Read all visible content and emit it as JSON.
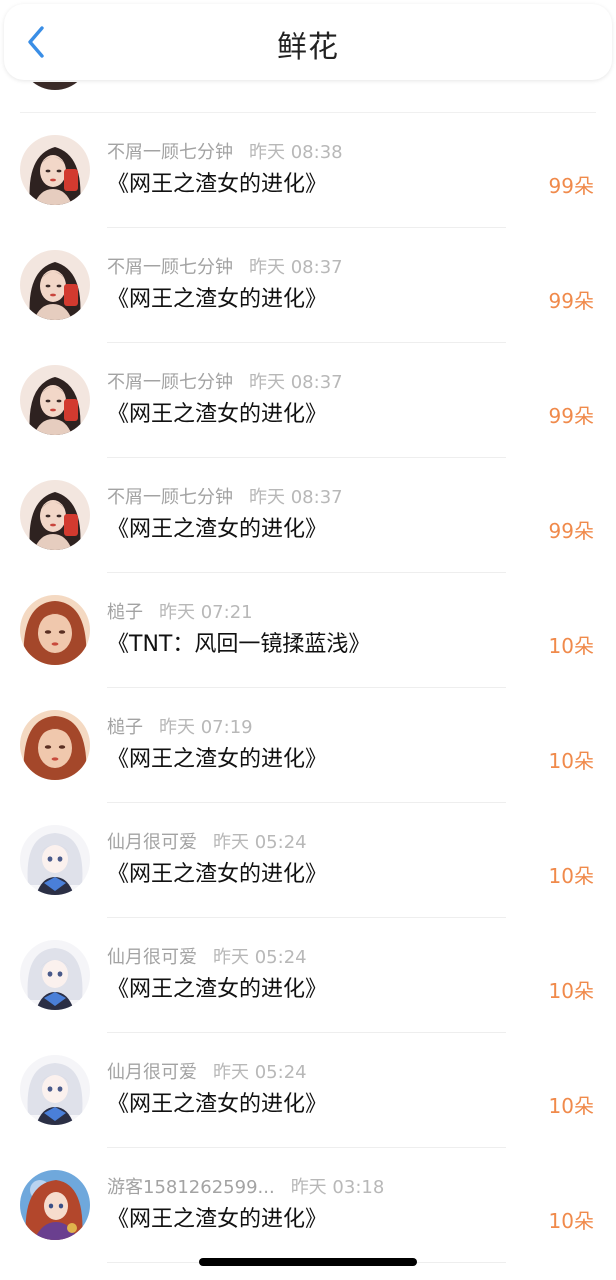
{
  "header": {
    "title": "鲜花",
    "back_icon": "chevron-left-icon",
    "accent_color": "#3a8ee6"
  },
  "amount_color": "#f08a4b",
  "records": [
    {
      "user": "不屑一顾七分钟",
      "time": "昨天 08:38",
      "book": "《网王之渣女的进化》",
      "amount": "99朵",
      "avatar": "portrait-red"
    },
    {
      "user": "不屑一顾七分钟",
      "time": "昨天 08:37",
      "book": "《网王之渣女的进化》",
      "amount": "99朵",
      "avatar": "portrait-red"
    },
    {
      "user": "不屑一顾七分钟",
      "time": "昨天 08:37",
      "book": "《网王之渣女的进化》",
      "amount": "99朵",
      "avatar": "portrait-red"
    },
    {
      "user": "不屑一顾七分钟",
      "time": "昨天 08:37",
      "book": "《网王之渣女的进化》",
      "amount": "99朵",
      "avatar": "portrait-red"
    },
    {
      "user": "槌子",
      "time": "昨天 07:21",
      "book": "《TNT：风回一镜揉蓝浅》",
      "amount": "10朵",
      "avatar": "portrait-auburn"
    },
    {
      "user": "槌子",
      "time": "昨天 07:19",
      "book": "《网王之渣女的进化》",
      "amount": "10朵",
      "avatar": "portrait-auburn"
    },
    {
      "user": "仙月很可爱",
      "time": "昨天 05:24",
      "book": "《网王之渣女的进化》",
      "amount": "10朵",
      "avatar": "anime-white"
    },
    {
      "user": "仙月很可爱",
      "time": "昨天 05:24",
      "book": "《网王之渣女的进化》",
      "amount": "10朵",
      "avatar": "anime-white"
    },
    {
      "user": "仙月很可爱",
      "time": "昨天 05:24",
      "book": "《网王之渣女的进化》",
      "amount": "10朵",
      "avatar": "anime-white"
    },
    {
      "user": "游客1581262599...",
      "time": "昨天 03:18",
      "book": "《网王之渣女的进化》",
      "amount": "10朵",
      "avatar": "anime-colorful"
    }
  ]
}
